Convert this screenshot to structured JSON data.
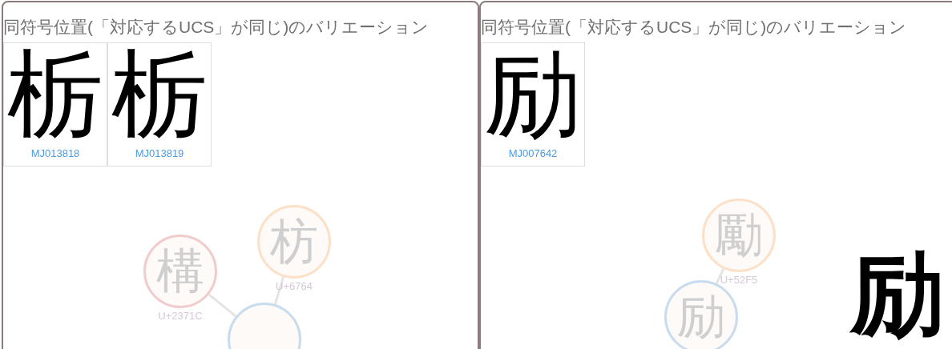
{
  "panels": [
    {
      "title": "同符号位置(「対応するUCS」が同じ)のバリエーション",
      "variants": [
        {
          "glyph": "栃",
          "code": "MJ013818"
        },
        {
          "glyph": "栃",
          "code": "MJ013819"
        }
      ],
      "graph": {
        "nodes": [
          {
            "glyph": "構",
            "code": "U+2371C",
            "color": "#f2cccc"
          },
          {
            "glyph": "枋",
            "code": "U+6764",
            "color": "#fde0c8"
          },
          {
            "color": "#c8dcee"
          }
        ]
      }
    },
    {
      "title": "同符号位置(「対応するUCS」が同じ)のバリエーション",
      "variants": [
        {
          "glyph": "励",
          "code": "MJ007642"
        }
      ],
      "graph": {
        "nodes": [
          {
            "glyph": "勵",
            "code": "U+52F5",
            "color": "#fde0c8"
          },
          {
            "glyph": "励",
            "color": "#c8dcee"
          }
        ]
      },
      "large_glyph": "励"
    }
  ]
}
